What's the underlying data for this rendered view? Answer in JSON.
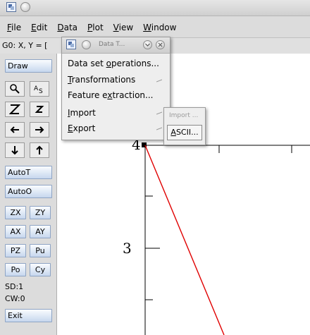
{
  "window": {
    "title_icon": "app-icon",
    "title_button": "round-button"
  },
  "menu": [
    "File",
    "Edit",
    "Data",
    "Plot",
    "View",
    "Window"
  ],
  "locator": {
    "text": "G0: X, Y = ["
  },
  "toolbar": {
    "draw": "Draw",
    "icons_row1": [
      "zoom-icon",
      "text-icon"
    ],
    "icons_row2": [
      "zoom-z-large-icon",
      "zoom-z-small-icon"
    ],
    "icons_row3": [
      "arrow-left-icon",
      "arrow-right-icon"
    ],
    "icons_row4": [
      "arrow-down-icon",
      "arrow-up-icon"
    ],
    "autot": "AutoT",
    "autoo": "AutoO",
    "zx": "ZX",
    "zy": "ZY",
    "ax": "AX",
    "ay": "AY",
    "pz": "PZ",
    "pu": "Pu",
    "po": "Po",
    "cy": "Cy",
    "sd": "SD:1",
    "cw": "CW:0",
    "exit": "Exit"
  },
  "plot": {
    "ytick_labels": [
      "4",
      "3"
    ],
    "line_color": "#e00000"
  },
  "data_menu": {
    "title": "Data T...",
    "items": [
      "Data set operations...",
      "Transformations",
      "Feature extraction...",
      "Import",
      "Export"
    ]
  },
  "import_submenu": {
    "title": "Import ...",
    "item": "ASCII..."
  }
}
